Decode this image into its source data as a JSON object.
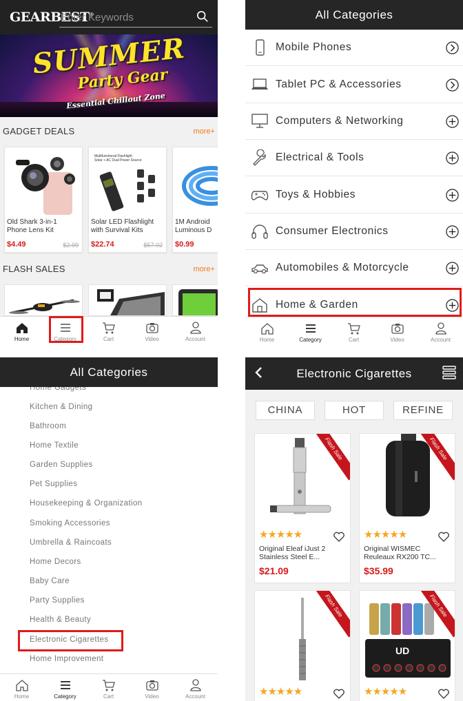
{
  "home": {
    "logo": "GEARBEST",
    "logo_mark": "®",
    "search_placeholder": "Enter Keywords",
    "banner": {
      "line1": "SUMMER",
      "line2": "Party Gear",
      "line3": "Essential Chillout Zone"
    },
    "gadget_deals": {
      "title": "GADGET DEALS",
      "more": "more+",
      "items": [
        {
          "name": "Old Shark 3-in-1\nPhone Lens Kit",
          "price": "$4.49",
          "old_price": "$2.99"
        },
        {
          "name": "Solar LED Flashlight\nwith Survival Kits",
          "price": "$22.74",
          "old_price": "$57.02"
        },
        {
          "name": "1M Android\nLuminous D",
          "price": "$0.99",
          "old_price": ""
        }
      ]
    },
    "flash_sales": {
      "title": "FLASH SALES",
      "more": "more+"
    }
  },
  "nav": [
    {
      "label": "Home",
      "icon": "home-icon"
    },
    {
      "label": "Category",
      "icon": "menu-icon"
    },
    {
      "label": "Cart",
      "icon": "cart-icon"
    },
    {
      "label": "Video",
      "icon": "camera-icon"
    },
    {
      "label": "Account",
      "icon": "user-icon"
    }
  ],
  "categories": {
    "title": "All Categories",
    "items": [
      {
        "label": "Mobile Phones",
        "icon": "phone-icon",
        "action": "chevron-right-icon"
      },
      {
        "label": "Tablet PC & Accessories",
        "icon": "laptop-icon",
        "action": "chevron-right-icon"
      },
      {
        "label": "Computers & Networking",
        "icon": "monitor-icon",
        "action": "plus-icon"
      },
      {
        "label": "Electrical & Tools",
        "icon": "wrench-icon",
        "action": "plus-icon"
      },
      {
        "label": "Toys & Hobbies",
        "icon": "gamepad-icon",
        "action": "plus-icon"
      },
      {
        "label": "Consumer Electronics",
        "icon": "headphones-icon",
        "action": "plus-icon"
      },
      {
        "label": "Automobiles & Motorcycle",
        "icon": "car-icon",
        "action": "plus-icon"
      },
      {
        "label": "Home & Garden",
        "icon": "house-icon",
        "action": "plus-icon"
      }
    ]
  },
  "subcategories": {
    "title": "All Categories",
    "items": [
      "Home Gadgets",
      "Kitchen & Dining",
      "Bathroom",
      "Home Textile",
      "Garden Supplies",
      "Pet Supplies",
      "Housekeeping & Organization",
      "Smoking Accessories",
      "Umbrella & Raincoats",
      "Home Decors",
      "Baby Care",
      "Party Supplies",
      "Health & Beauty",
      "Electronic Cigarettes",
      "Home Improvement"
    ]
  },
  "listing": {
    "title": "Electronic Cigarettes",
    "filters": [
      "CHINA",
      "HOT",
      "REFINE"
    ],
    "ribbon": "Flash Sale",
    "stars": "★★★★★",
    "products": [
      {
        "name": "Original Eleaf iJust 2\nStainless Steel E...",
        "price": "$21.09"
      },
      {
        "name": "Original WISMEC\nReuleaux RX200 TC...",
        "price": "$35.99"
      },
      {
        "name": "",
        "price": ""
      },
      {
        "name": "",
        "price": ""
      }
    ]
  },
  "colors": {
    "accent_red": "#d61a1a",
    "highlight": "#e01a1a",
    "more_orange": "#f07a1a",
    "header_dark": "#262626",
    "star": "#f5a623"
  }
}
